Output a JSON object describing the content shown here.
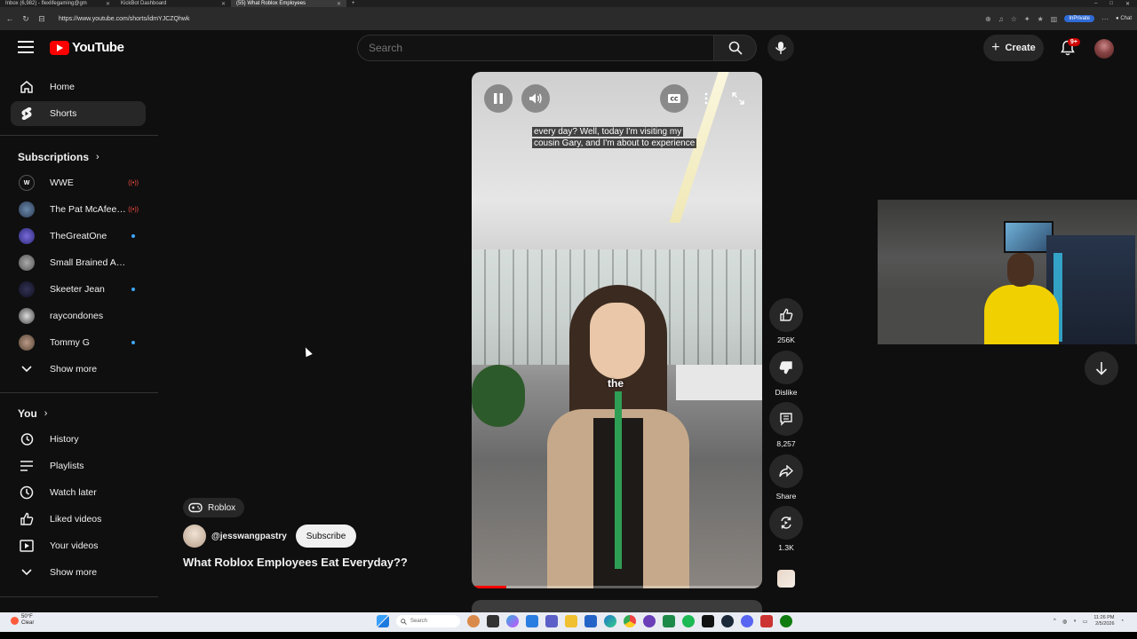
{
  "browser": {
    "tabs": [
      {
        "title": "Inbox (6,982) - flexlifegaming@gm"
      },
      {
        "title": "KickBot Dashboard"
      },
      {
        "title": "(55) What Roblox Employees"
      }
    ],
    "url": "https://www.youtube.com/shorts/idmYJCZQhwk",
    "inprivate_label": "InPrivate",
    "chat_label": "Chat"
  },
  "header": {
    "logo_text": "YouTube",
    "search_placeholder": "Search",
    "create_label": "Create",
    "notification_count": "9+"
  },
  "sidebar": {
    "main": [
      {
        "label": "Home",
        "icon": "home-icon"
      },
      {
        "label": "Shorts",
        "icon": "shorts-icon"
      }
    ],
    "subscriptions_title": "Subscriptions",
    "subscriptions": [
      {
        "name": "WWE",
        "status": "live"
      },
      {
        "name": "The Pat McAfee ...",
        "status": "live"
      },
      {
        "name": "TheGreatOne",
        "status": "new"
      },
      {
        "name": "Small Brained Ame...",
        "status": "none"
      },
      {
        "name": "Skeeter Jean",
        "status": "new"
      },
      {
        "name": "raycondones",
        "status": "none"
      },
      {
        "name": "Tommy G",
        "status": "new"
      }
    ],
    "show_more_1": "Show more",
    "you_title": "You",
    "you_items": [
      {
        "label": "History",
        "icon": "history-icon"
      },
      {
        "label": "Playlists",
        "icon": "playlists-icon"
      },
      {
        "label": "Watch later",
        "icon": "watch-later-icon"
      },
      {
        "label": "Liked videos",
        "icon": "like-icon"
      },
      {
        "label": "Your videos",
        "icon": "your-videos-icon"
      }
    ],
    "show_more_2": "Show more"
  },
  "video": {
    "caption_line1": "every day? Well, today I'm visiting my",
    "caption_line2": "cousin Gary, and I'm about to experience",
    "word_caption": "the",
    "progress": 0.12
  },
  "actions": {
    "likes": "256K",
    "dislike_label": "Dislike",
    "comments": "8,257",
    "share_label": "Share",
    "remix_count": "1.3K"
  },
  "info": {
    "tag": "Roblox",
    "channel": "@jesswangpastry",
    "subscribe_label": "Subscribe",
    "title": "What Roblox Employees Eat Everyday??"
  },
  "taskbar": {
    "weather_temp": "50°F",
    "weather_cond": "Clear",
    "search_label": "Search",
    "time": "11:26 PM",
    "date": "2/5/2026"
  },
  "colors": {
    "background": "#0f0f0f",
    "brand_red": "#ff0000",
    "chip": "#272727",
    "live": "#ff4e45",
    "new_dot": "#3ea6ff"
  }
}
